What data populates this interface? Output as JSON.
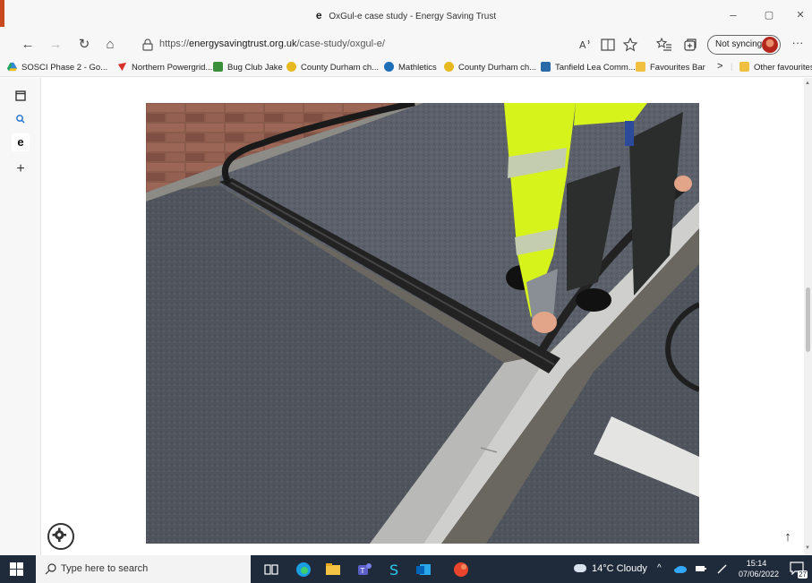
{
  "window": {
    "title": "OxGul-e case study - Energy Saving Trust",
    "minimize": "–",
    "maximize": "▢",
    "close": "✕"
  },
  "toolbar": {
    "back": "←",
    "forward": "→",
    "refresh": "↻",
    "home": "⌂",
    "url_prefix": "https://",
    "url_domain": "energysavingtrust.org.uk",
    "url_path": "/case-study/oxgul-e/",
    "sync_label": "Not syncing",
    "more": "···"
  },
  "favourites": [
    {
      "label": "SOSCI Phase 2 - Go...",
      "color": "#2f8ad8",
      "icon": "drive-icon"
    },
    {
      "label": "Northern Powergrid...",
      "color": "#d6302a",
      "icon": "powergrid-icon"
    },
    {
      "label": "Bug Club Jake",
      "color": "#3a8f3a",
      "icon": "bugclub-icon"
    },
    {
      "label": "County Durham ch...",
      "color": "#e8b820",
      "icon": "durham-icon"
    },
    {
      "label": "Mathletics",
      "color": "#1d6fb8",
      "icon": "mathletics-icon"
    },
    {
      "label": "County Durham ch...",
      "color": "#e8b820",
      "icon": "durham-icon"
    },
    {
      "label": "Tanfield Lea Comm...",
      "color": "#2a6aa8",
      "icon": "tanfield-icon"
    },
    {
      "label": "Favourites Bar",
      "color": "#f0c040",
      "icon": "folder-icon"
    },
    {
      "label": "Other favourites",
      "color": "#f0c040",
      "icon": "folder-icon"
    }
  ],
  "favourites_overflow": ">",
  "content": {
    "scroll_top_arrow": "↑"
  },
  "taskbar": {
    "search_placeholder": "Type here to search",
    "weather": "14°C  Cloudy",
    "tray_chevron": "^",
    "time": "15:14",
    "date": "07/06/2022",
    "notifications": "27"
  },
  "colors": {
    "taskbar": "#1f2a3a",
    "chrome": "#f7f7f7",
    "hi_vis": "#d7f31c"
  }
}
